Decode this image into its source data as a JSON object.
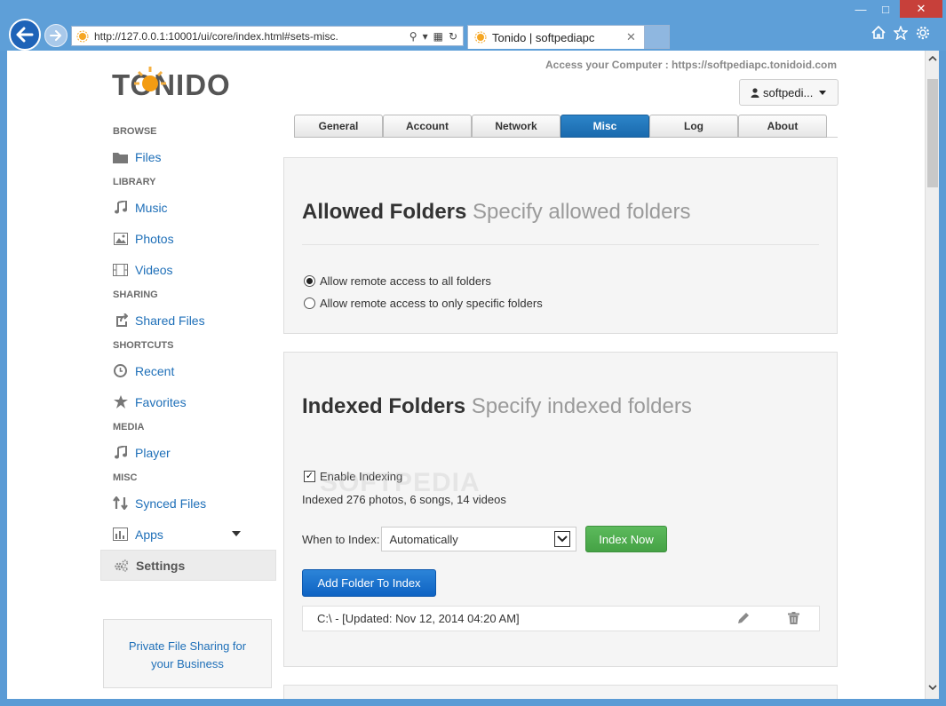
{
  "browser": {
    "address_url": "http://127.0.0.1:10001/ui/core/index.html#sets-misc.",
    "tab_title": "Tonido | softpediapc",
    "window_controls": {
      "minimize": "—",
      "maximize": "□",
      "close": "✕"
    }
  },
  "header": {
    "logo_text": "TONIDO",
    "access_text": "Access your Computer : https://softpediapc.tonidoid.com",
    "user_label": "softpedi..."
  },
  "sidebar": {
    "sections": [
      {
        "heading": "BROWSE"
      },
      {
        "heading": "LIBRARY"
      },
      {
        "heading": "SHARING"
      },
      {
        "heading": "SHORTCUTS"
      },
      {
        "heading": "MEDIA"
      },
      {
        "heading": "MISC"
      }
    ],
    "items": {
      "files": "Files",
      "music": "Music",
      "photos": "Photos",
      "videos": "Videos",
      "shared_files": "Shared Files",
      "recent": "Recent",
      "favorites": "Favorites",
      "player": "Player",
      "synced_files": "Synced Files",
      "apps": "Apps",
      "settings": "Settings"
    },
    "promo_line1": "Private File Sharing for",
    "promo_line2": "your Business"
  },
  "settings_tabs": [
    "General",
    "Account",
    "Network",
    "Misc",
    "Log",
    "About"
  ],
  "active_tab": "Misc",
  "allowed_folders": {
    "title": "Allowed Folders",
    "subtitle": "Specify allowed folders",
    "option_all": "Allow remote access to all folders",
    "option_specific": "Allow remote access to only specific folders",
    "selected": "all"
  },
  "indexed_folders": {
    "title": "Indexed Folders",
    "subtitle": "Specify indexed folders",
    "enable_label": "Enable Indexing",
    "enabled": true,
    "summary": "Indexed 276 photos, 6 songs, 14 videos",
    "when_label": "When to Index:",
    "when_value": "Automatically",
    "index_now": "Index Now",
    "add_folder": "Add Folder To Index",
    "folders": [
      "C:\\ - [Updated: Nov 12, 2014 04:20 AM]"
    ]
  },
  "watermark": "SOFTPEDIA",
  "colors": {
    "accent_blue": "#1e6fb8",
    "tab_active": "#1a6aae",
    "green_button": "#45a245",
    "primary_button": "#0f63c3",
    "chrome": "#5e9fd8"
  }
}
